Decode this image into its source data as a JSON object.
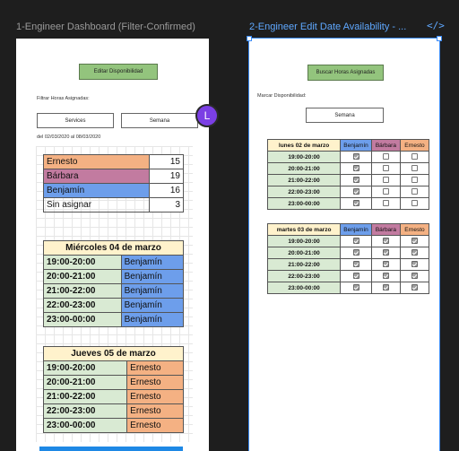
{
  "frames": {
    "left_title": "1-Engineer Dashboard (Filter-Confirmed)",
    "right_title": "2-Engineer Edit Date Availability - ...",
    "code_icon": "</>"
  },
  "avatar": {
    "letter": "L",
    "color": "#7b3fe4"
  },
  "dashboard": {
    "edit_button": "Editar Disponibilidad",
    "filter_label": "Filtrar Horas Asignadas:",
    "services_button": "Services",
    "week_button": "Semana",
    "date_range": "del 02/03/2020 al 08/03/2020",
    "summary": [
      {
        "name": "Ernesto",
        "count": "15",
        "color": "orange"
      },
      {
        "name": "Bárbara",
        "count": "19",
        "color": "purple"
      },
      {
        "name": "Benjamín",
        "count": "16",
        "color": "blue"
      },
      {
        "name": "Sin asignar",
        "count": "3",
        "color": "none"
      }
    ],
    "day1": {
      "title": "Miércoles 04 de marzo",
      "rows": [
        {
          "slot": "19:00-20:00",
          "engineer": "Benjamín"
        },
        {
          "slot": "20:00-21:00",
          "engineer": "Benjamín"
        },
        {
          "slot": "21:00-22:00",
          "engineer": "Benjamín"
        },
        {
          "slot": "22:00-23:00",
          "engineer": "Benjamín"
        },
        {
          "slot": "23:00-00:00",
          "engineer": "Benjamín"
        }
      ]
    },
    "day2": {
      "title": "Jueves 05 de marzo",
      "rows": [
        {
          "slot": "19:00-20:00",
          "engineer": "Ernesto"
        },
        {
          "slot": "20:00-21:00",
          "engineer": "Ernesto"
        },
        {
          "slot": "21:00-22:00",
          "engineer": "Ernesto"
        },
        {
          "slot": "22:00-23:00",
          "engineer": "Ernesto"
        },
        {
          "slot": "23:00-00:00",
          "engineer": "Ernesto"
        }
      ]
    }
  },
  "edit": {
    "search_button": "Buscar Horas Asignadas",
    "mark_label": "Marcar Disponibilidad:",
    "week_button": "Semana",
    "headers": [
      "Benjamín",
      "Bárbara",
      "Ernesto"
    ],
    "day1": {
      "title": "lunes 02 de marzo",
      "rows": [
        {
          "slot": "19:00-20:00",
          "checks": [
            true,
            false,
            false
          ]
        },
        {
          "slot": "20:00-21:00",
          "checks": [
            true,
            false,
            false
          ]
        },
        {
          "slot": "21:00-22:00",
          "checks": [
            true,
            false,
            false
          ]
        },
        {
          "slot": "22:00-23:00",
          "checks": [
            true,
            false,
            false
          ]
        },
        {
          "slot": "23:00-00:00",
          "checks": [
            true,
            false,
            false
          ]
        }
      ]
    },
    "day2": {
      "title": "martes 03 de marzo",
      "rows": [
        {
          "slot": "19:00-20:00",
          "checks": [
            true,
            true,
            true
          ]
        },
        {
          "slot": "20:00-21:00",
          "checks": [
            true,
            true,
            true
          ]
        },
        {
          "slot": "21:00-22:00",
          "checks": [
            true,
            true,
            true
          ]
        },
        {
          "slot": "22:00-23:00",
          "checks": [
            true,
            true,
            true
          ]
        },
        {
          "slot": "23:00-00:00",
          "checks": [
            true,
            true,
            true
          ]
        }
      ]
    }
  }
}
